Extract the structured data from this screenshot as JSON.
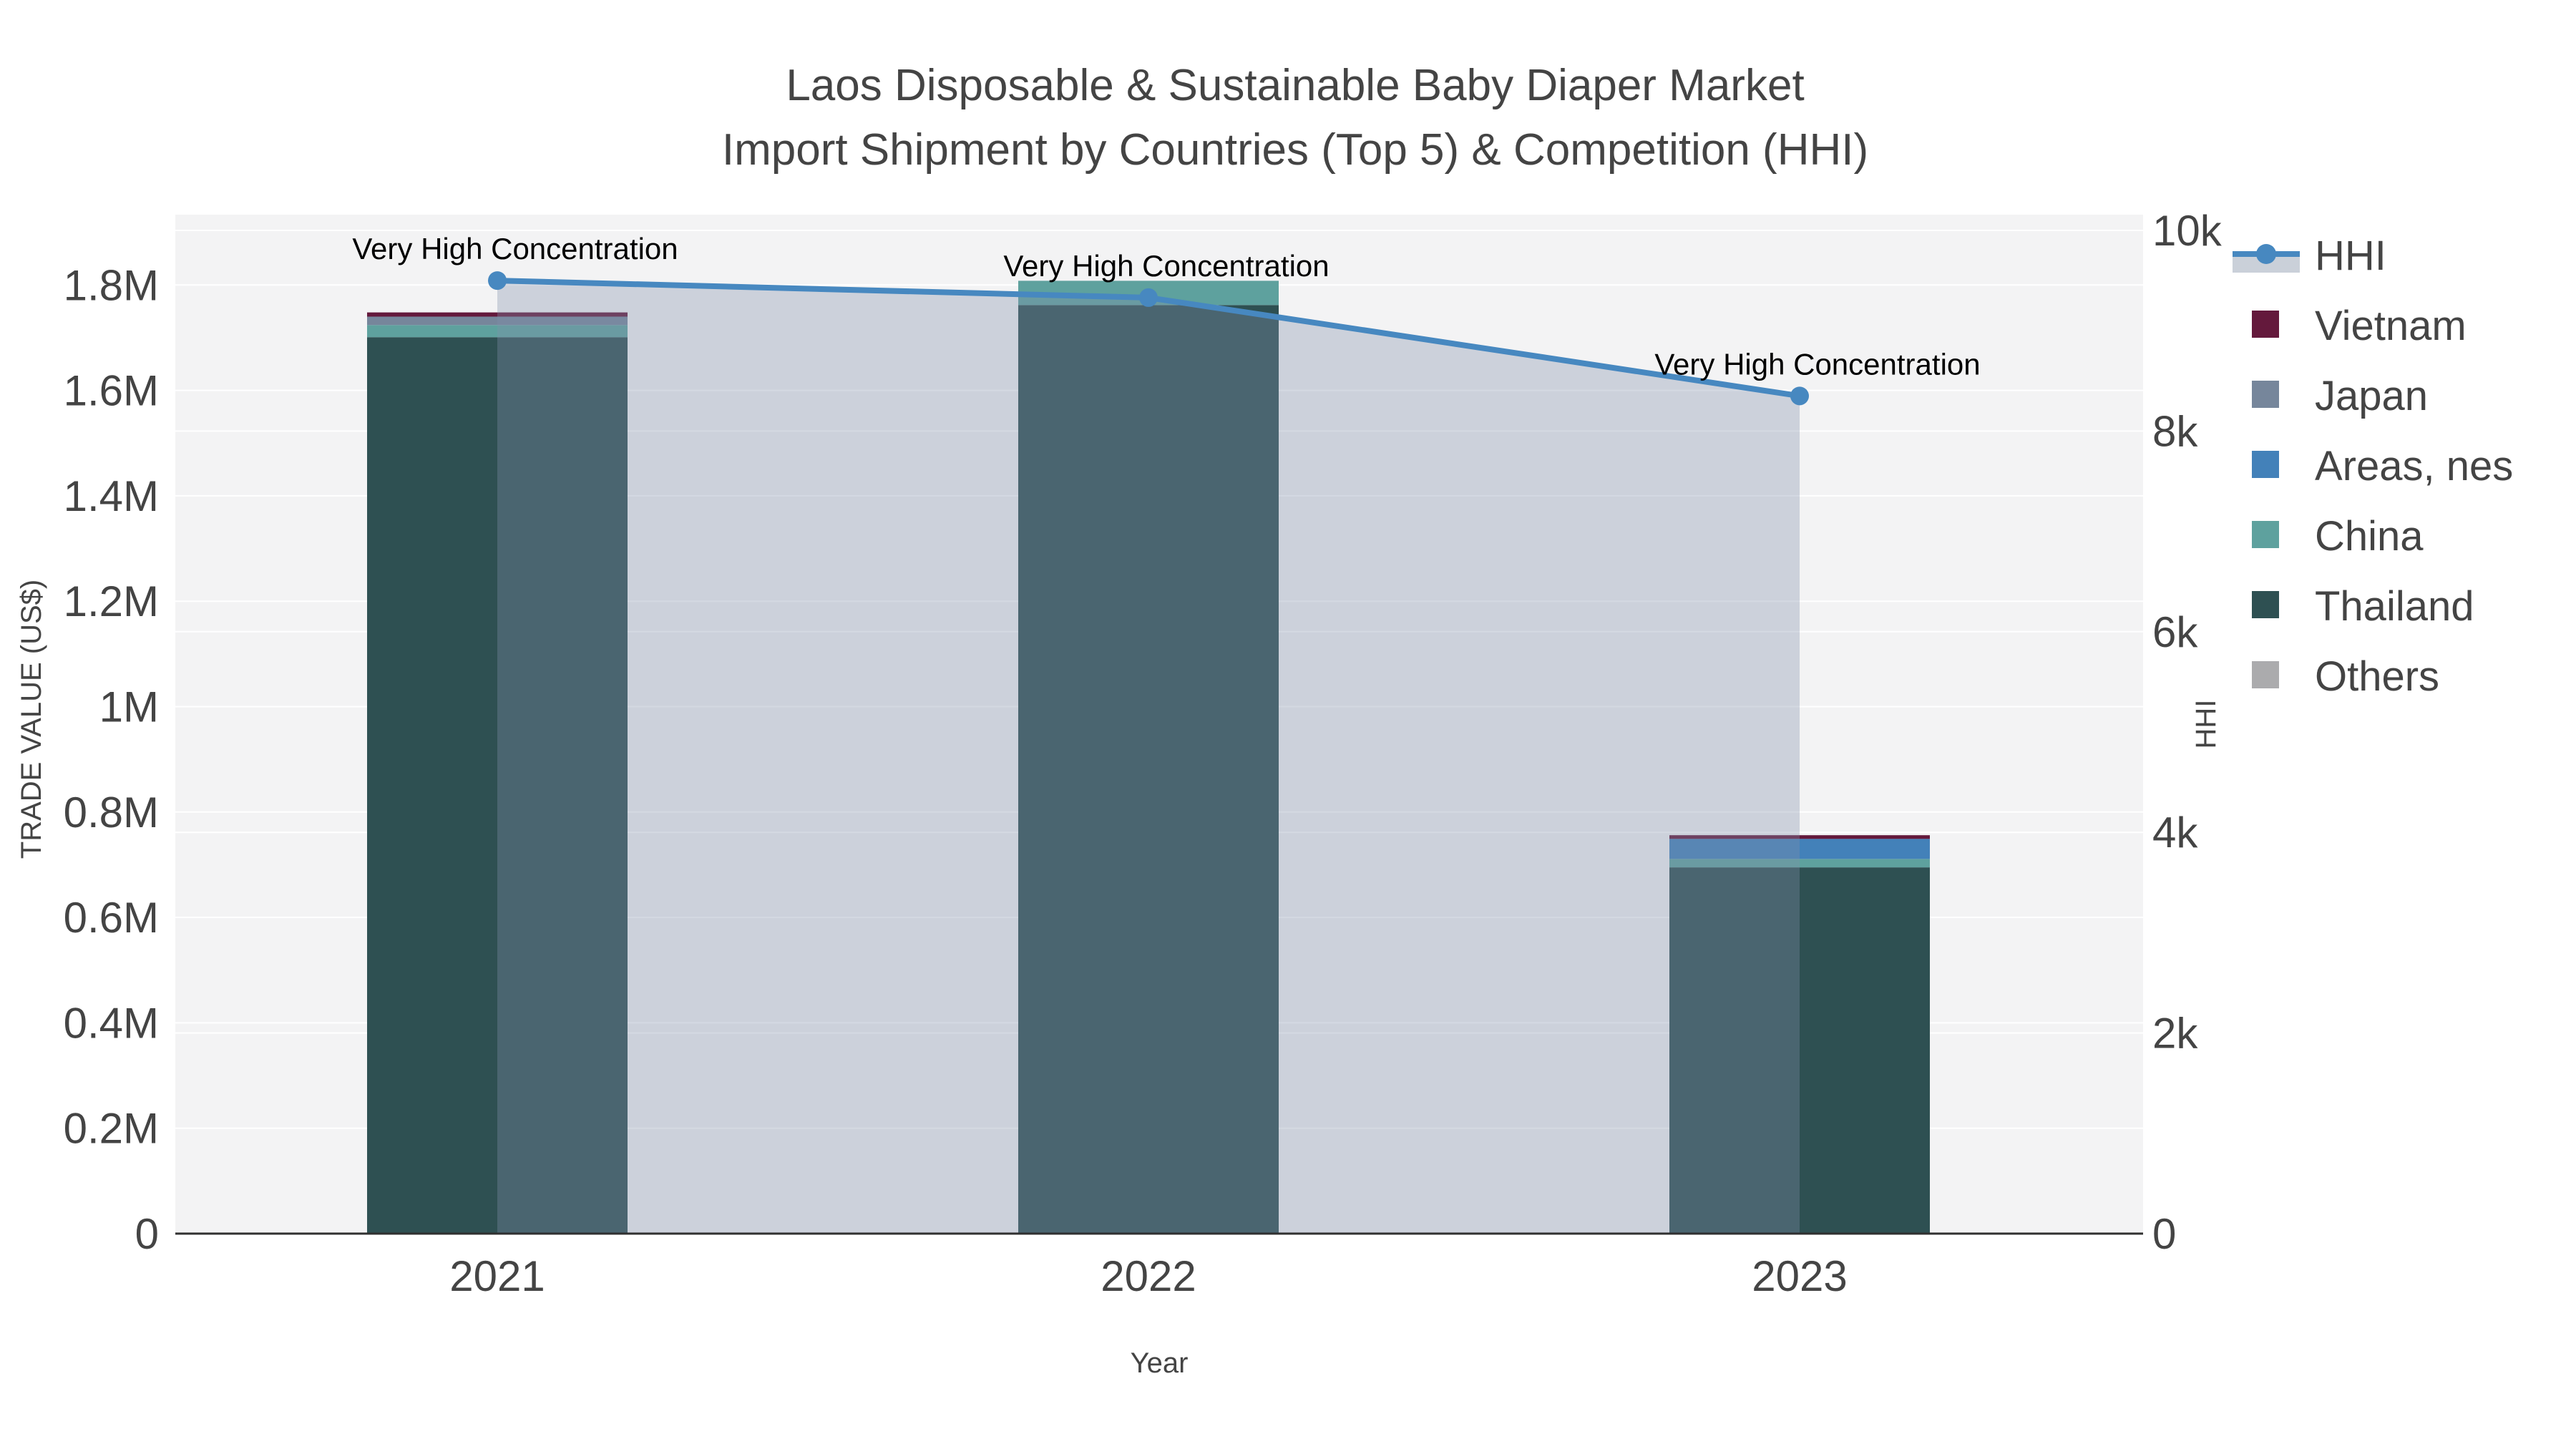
{
  "title": {
    "line1": "Laos Disposable & Sustainable Baby Diaper Market",
    "line2": "Import Shipment by Countries (Top 5) & Competition (HHI)"
  },
  "axes": {
    "left": {
      "title": "TRADE VALUE (US$)",
      "tick_labels": [
        "0",
        "0.2M",
        "0.4M",
        "0.6M",
        "0.8M",
        "1M",
        "1.2M",
        "1.4M",
        "1.6M",
        "1.8M"
      ],
      "tick_values": [
        0,
        200000,
        400000,
        600000,
        800000,
        1000000,
        1200000,
        1400000,
        1600000,
        1800000
      ],
      "range": [
        0,
        1933000
      ]
    },
    "right": {
      "title": "HHI",
      "tick_labels": [
        "0",
        "2k",
        "4k",
        "6k",
        "8k",
        "10k"
      ],
      "tick_values": [
        0,
        2000,
        4000,
        6000,
        8000,
        10000
      ],
      "range": [
        0,
        10160
      ]
    },
    "x": {
      "title": "Year",
      "categories": [
        "2021",
        "2022",
        "2023"
      ]
    }
  },
  "chart_data": {
    "type": "stacked-bar+line",
    "categories": [
      "2021",
      "2022",
      "2023"
    ],
    "title": "Laos Disposable & Sustainable Baby Diaper Market Import Shipment by Countries (Top 5) & Competition (HHI)",
    "xlabel": "Year",
    "ylabel_left": "TRADE VALUE (US$)",
    "ylabel_right": "HHI",
    "ylim_left": [
      0,
      1933000
    ],
    "ylim_right": [
      0,
      10160
    ],
    "grid": true,
    "legend_position": "right",
    "stack_order_bottom_to_top": [
      "Others",
      "Thailand",
      "China",
      "Areas, nes",
      "Japan",
      "Vietnam"
    ],
    "series": [
      {
        "name": "Vietnam",
        "color": "#64193c",
        "values": [
          8000,
          0,
          7000
        ]
      },
      {
        "name": "Japan",
        "color": "#76869b",
        "values": [
          16000,
          0,
          0
        ]
      },
      {
        "name": "Areas, nes",
        "color": "#4381b9",
        "values": [
          0,
          0,
          38000
        ]
      },
      {
        "name": "China",
        "color": "#5ea19e",
        "values": [
          23000,
          46000,
          16000
        ]
      },
      {
        "name": "Thailand",
        "color": "#2e5052",
        "values": [
          1701000,
          1762000,
          695000
        ]
      },
      {
        "name": "Others",
        "color": "#ababad",
        "values": [
          0,
          0,
          0
        ]
      }
    ],
    "bar_totals": [
      1748000,
      1808000,
      756000
    ],
    "line_series": {
      "name": "HHI",
      "color": "#4788c0",
      "area_fill": "rgba(128,144,170,0.34)",
      "values": [
        9500,
        9330,
        8350
      ]
    },
    "annotations": [
      {
        "text": "Very High Concentration",
        "x": "2021",
        "y": 9500
      },
      {
        "text": "Very High Concentration",
        "x": "2022",
        "y": 9330
      },
      {
        "text": "Very High Concentration",
        "x": "2023",
        "y": 8350
      }
    ],
    "legend": [
      "HHI",
      "Vietnam",
      "Japan",
      "Areas, nes",
      "China",
      "Thailand",
      "Others"
    ]
  },
  "style": {
    "plot_bg": "#f3f3f4",
    "grid_color": "#ffffff",
    "axis_line": "#303030",
    "text_color": "#444444",
    "annotation_color": "#000000",
    "legend_band": "#cad0d9"
  }
}
